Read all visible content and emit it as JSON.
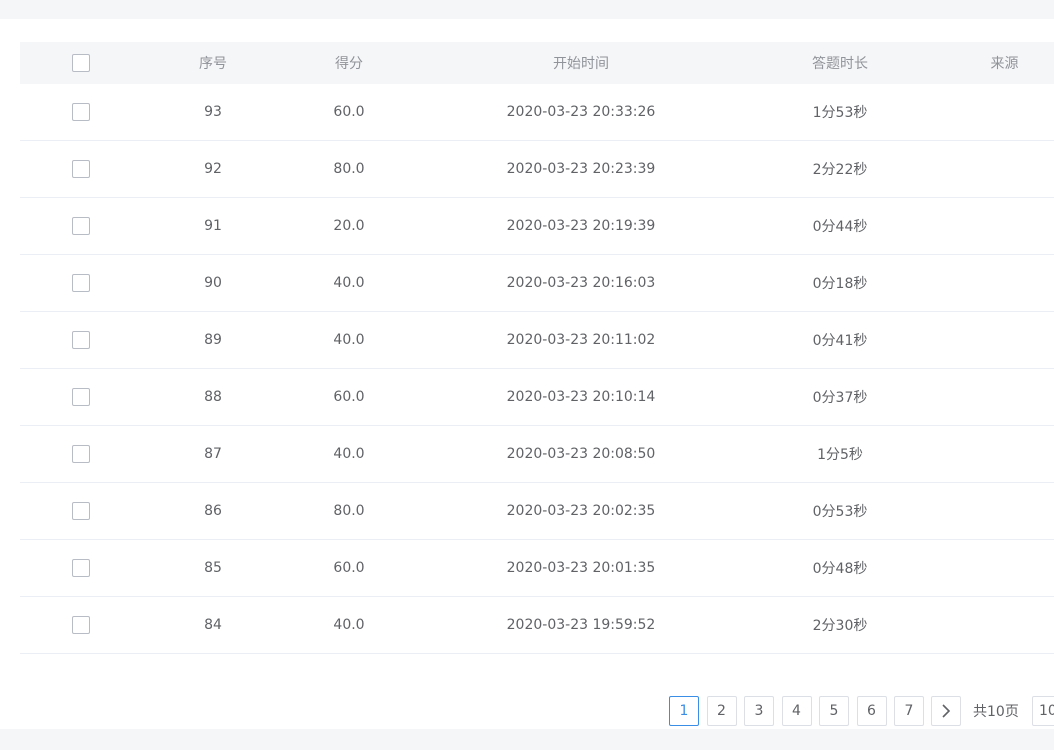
{
  "table": {
    "headers": {
      "seq": "序号",
      "score": "得分",
      "start_time": "开始时间",
      "duration": "答题时长",
      "source": "来源"
    },
    "rows": [
      {
        "seq": "93",
        "score": "60.0",
        "start_time": "2020-03-23 20:33:26",
        "duration": "1分53秒",
        "source": ""
      },
      {
        "seq": "92",
        "score": "80.0",
        "start_time": "2020-03-23 20:23:39",
        "duration": "2分22秒",
        "source": ""
      },
      {
        "seq": "91",
        "score": "20.0",
        "start_time": "2020-03-23 20:19:39",
        "duration": "0分44秒",
        "source": ""
      },
      {
        "seq": "90",
        "score": "40.0",
        "start_time": "2020-03-23 20:16:03",
        "duration": "0分18秒",
        "source": ""
      },
      {
        "seq": "89",
        "score": "40.0",
        "start_time": "2020-03-23 20:11:02",
        "duration": "0分41秒",
        "source": ""
      },
      {
        "seq": "88",
        "score": "60.0",
        "start_time": "2020-03-23 20:10:14",
        "duration": "0分37秒",
        "source": ""
      },
      {
        "seq": "87",
        "score": "40.0",
        "start_time": "2020-03-23 20:08:50",
        "duration": "1分5秒",
        "source": ""
      },
      {
        "seq": "86",
        "score": "80.0",
        "start_time": "2020-03-23 20:02:35",
        "duration": "0分53秒",
        "source": ""
      },
      {
        "seq": "85",
        "score": "60.0",
        "start_time": "2020-03-23 20:01:35",
        "duration": "0分48秒",
        "source": ""
      },
      {
        "seq": "84",
        "score": "40.0",
        "start_time": "2020-03-23 19:59:52",
        "duration": "2分30秒",
        "source": ""
      }
    ]
  },
  "pagination": {
    "pages": [
      "1",
      "2",
      "3",
      "4",
      "5",
      "6",
      "7"
    ],
    "current": "1",
    "next_icon": "chevron-right-icon",
    "total_label": "共10页",
    "page_size": "10"
  },
  "colors": {
    "accent": "#3a8ee6",
    "header_bg": "#f5f6f8",
    "page_bg": "#f5f6f8"
  }
}
